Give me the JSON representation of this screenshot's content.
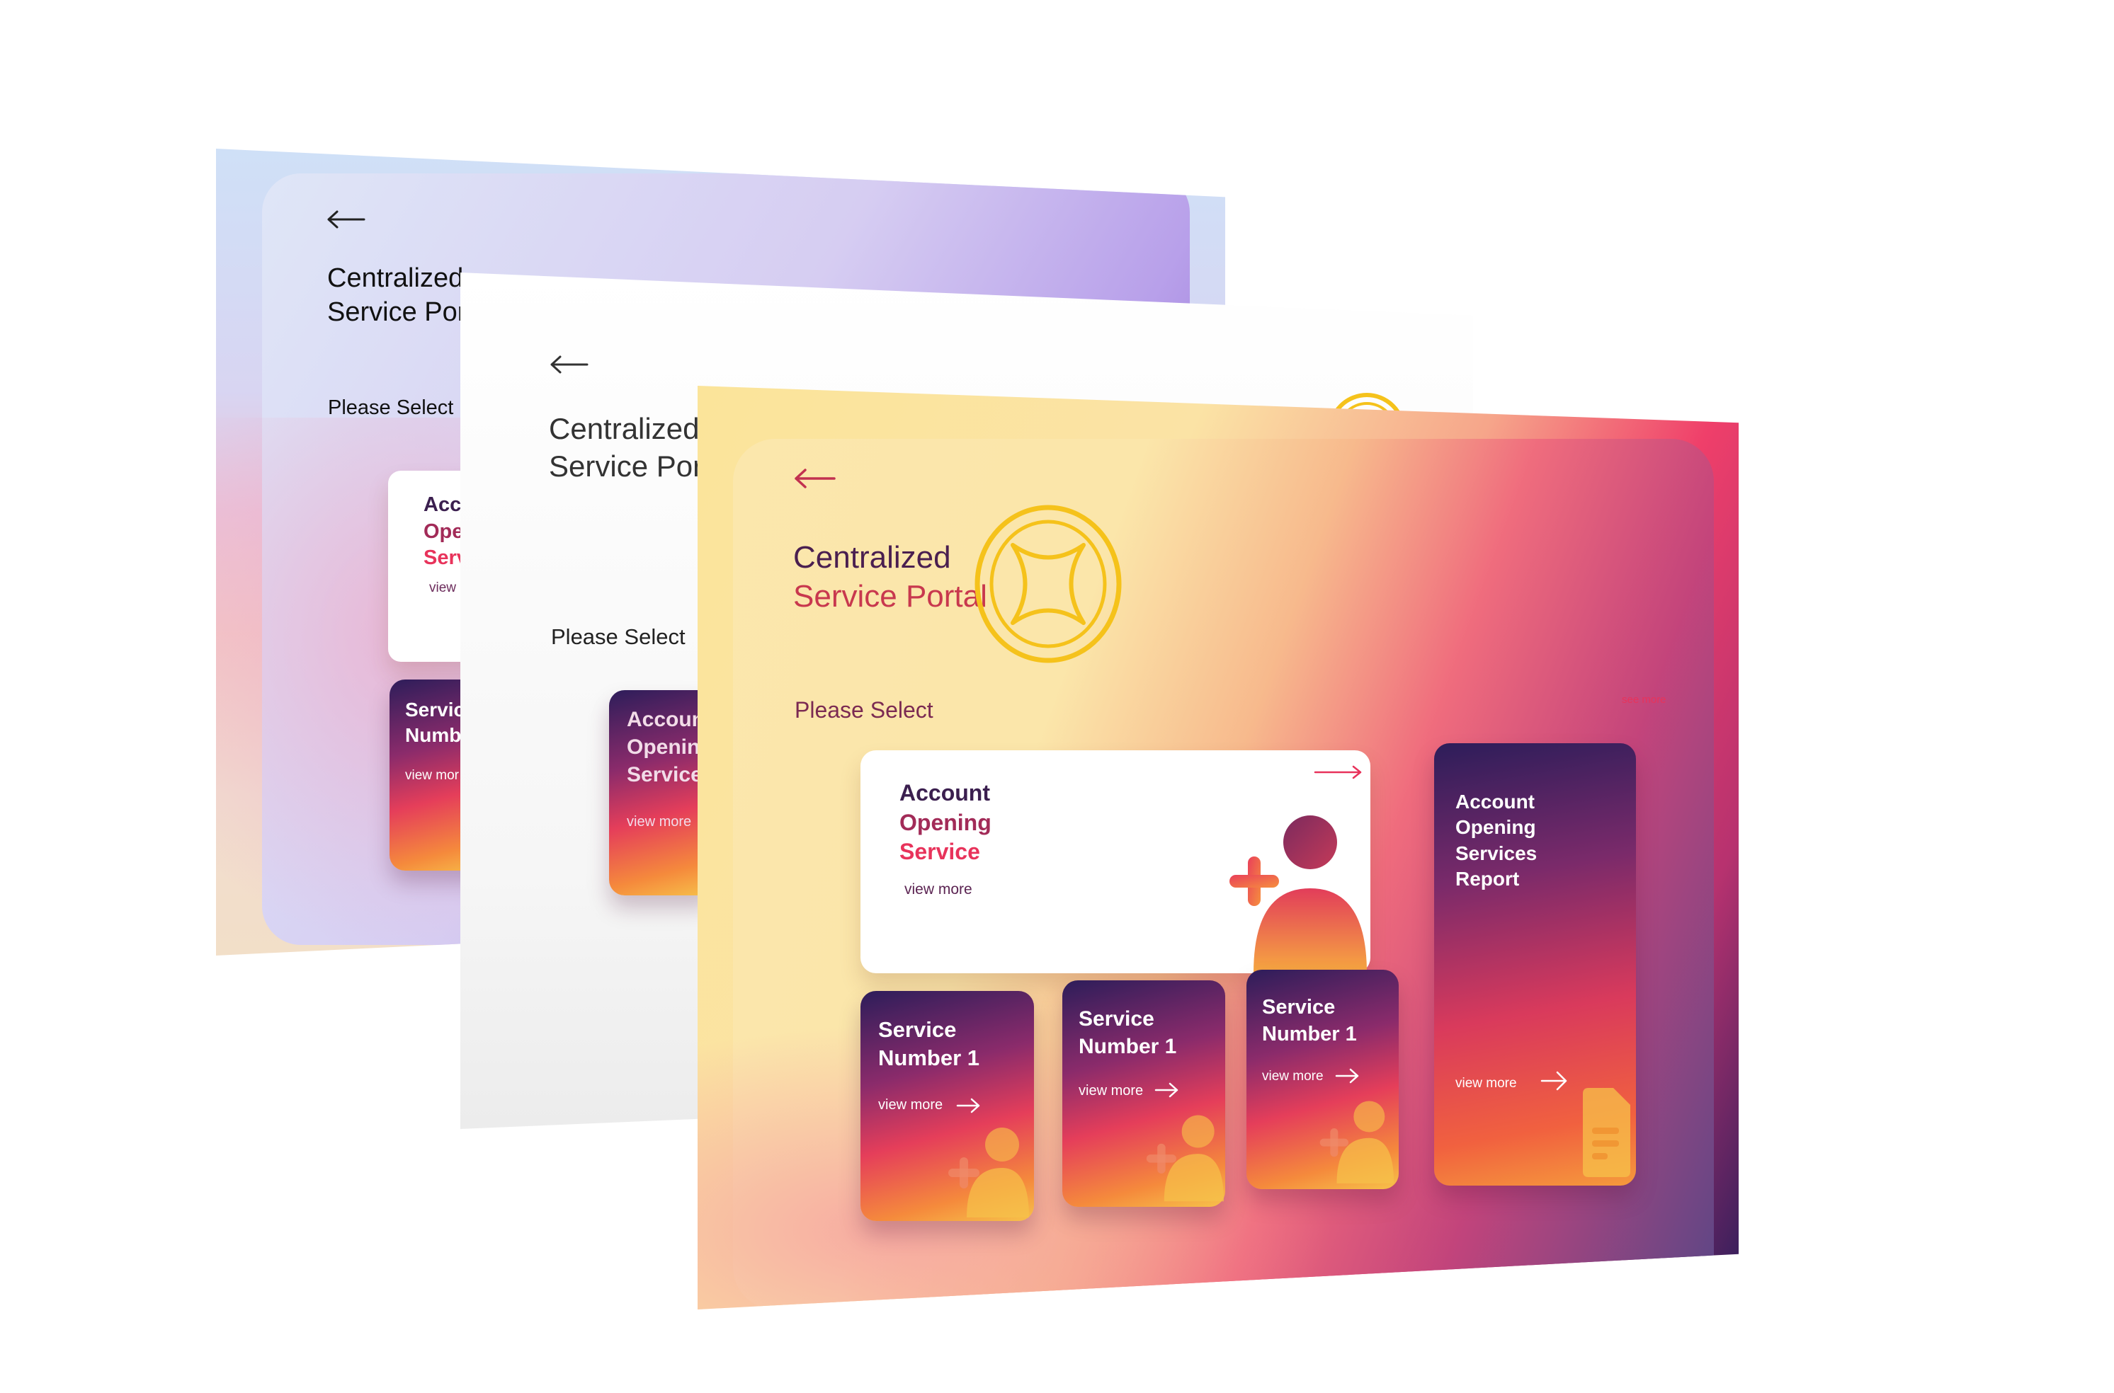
{
  "back_screen": {
    "title_line1": "Centralized",
    "title_line2": "Service Port",
    "please_select": "Please Select",
    "card_featured": {
      "line1": "Acco",
      "line2": "Open",
      "line3": "Serv",
      "view_more": "view"
    },
    "card_service": {
      "line1": "Servic",
      "line2": "Numb",
      "view_more": "view mor"
    }
  },
  "middle_screen": {
    "title_line1": "Centralized",
    "title_line2": "Service Porta",
    "please_select": "Please Select",
    "card_featured": {
      "line1": "Accoun",
      "line2": "Openin",
      "line3": "Service",
      "view_more": "view more"
    }
  },
  "front_screen": {
    "title_line1": "Centralized",
    "title_line2": "Service Portal",
    "please_select": "Please Select",
    "see_more": "see more",
    "featured_card": {
      "line1": "Account",
      "line2": "Opening",
      "line3": "Service",
      "view_more": "view more"
    },
    "report_card": {
      "line1": "Account",
      "line2": "Opening",
      "line3": "Services",
      "line4": "Report",
      "view_more": "view more"
    },
    "service_cards": [
      {
        "line1": "Service",
        "line2": "Number 1",
        "view_more": "view more"
      },
      {
        "line1": "Service",
        "line2": "Number 1",
        "view_more": "view more"
      },
      {
        "line1": "Service",
        "line2": "Number 1",
        "view_more": "view more"
      }
    ]
  },
  "colors": {
    "title_dark": "#3b1f4f",
    "accent_red": "#e8335b",
    "emblem_gold": "#f5c21b",
    "text_dark": "#222222"
  },
  "icons": [
    "back-arrow-icon",
    "emblem-icon",
    "arrow-right-icon",
    "add-user-icon",
    "document-icon"
  ]
}
